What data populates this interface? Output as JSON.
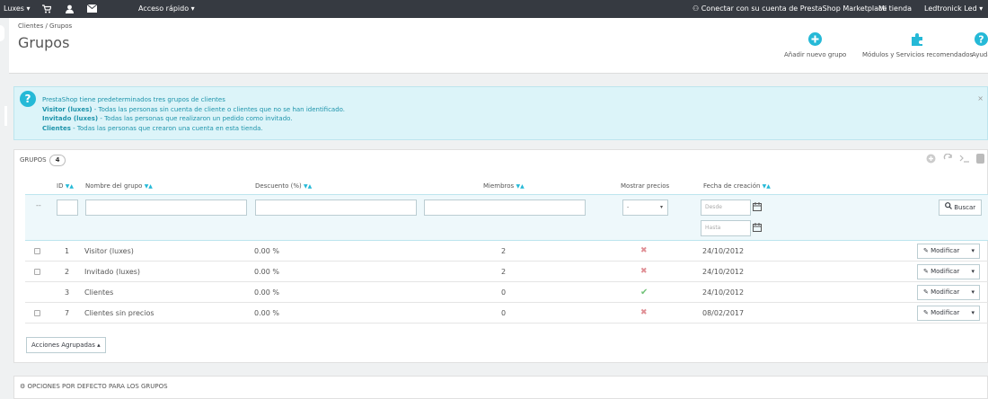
{
  "topbar": {
    "shop": "Luxes",
    "quick_access": "Acceso rápido",
    "marketplace": "Conectar con su cuenta de PrestaShop Marketplace",
    "my_shop": "Mi tienda",
    "user": "Ledtronick Led"
  },
  "header": {
    "breadcrumb": "Clientes  /  Grupos",
    "title": "Grupos",
    "buttons": {
      "add": "Añadir nuevo grupo",
      "modules": "Módulos y Servicios recomendados",
      "help": "Ayuda"
    }
  },
  "alert": {
    "intro": "PrestaShop tiene predeterminados tres grupos de clientes",
    "lines": [
      {
        "bold": "Visitor (luxes)",
        "text": " - Todas las personas sin cuenta de cliente o clientes que no se han identificado."
      },
      {
        "bold": "Invitado (luxes)",
        "text": " - Todas las personas que realizaron un pedido como invitado."
      },
      {
        "bold": "Clientes",
        "text": " - Todas las personas que crearon una cuenta en esta tienda."
      }
    ],
    "close": "×"
  },
  "panel": {
    "title": "GRUPOS",
    "count": "4",
    "columns": {
      "id": "ID",
      "name": "Nombre del grupo",
      "discount": "Descuento (%)",
      "members": "Miembros",
      "show_prices": "Mostrar precios",
      "created": "Fecha de creación"
    },
    "filter": {
      "select_value": "-",
      "from_placeholder": "Desde",
      "to_placeholder": "Hasta",
      "search_label": "Buscar",
      "dash": "--"
    },
    "rows": [
      {
        "checkbox": true,
        "id": "1",
        "name": "Visitor (luxes)",
        "discount": "0.00 %",
        "members": "2",
        "show_prices": false,
        "date": "24/10/2012",
        "action": "Modificar"
      },
      {
        "checkbox": true,
        "id": "2",
        "name": "Invitado (luxes)",
        "discount": "0.00 %",
        "members": "2",
        "show_prices": false,
        "date": "24/10/2012",
        "action": "Modificar"
      },
      {
        "checkbox": false,
        "id": "3",
        "name": "Clientes",
        "discount": "0.00 %",
        "members": "0",
        "show_prices": true,
        "date": "24/10/2012",
        "action": "Modificar"
      },
      {
        "checkbox": true,
        "id": "7",
        "name": "Clientes sin precios",
        "discount": "0.00 %",
        "members": "0",
        "show_prices": false,
        "date": "08/02/2017",
        "action": "Modificar"
      }
    ],
    "bulk_actions": "Acciones Agrupadas"
  },
  "options_panel": {
    "title": "OPCIONES POR DEFECTO PARA LOS GRUPOS"
  },
  "colors": {
    "topbar": "#363a41",
    "accent": "#25b9d7",
    "alert_bg": "#dcf4f9",
    "no": "#e08f95",
    "yes": "#72c279"
  },
  "icons": {
    "cart": "cart-icon",
    "user": "user-icon",
    "mail": "envelope-icon",
    "add": "plus-circle-icon",
    "modules": "puzzle-icon",
    "help": "question-circle-icon",
    "search": "search-icon",
    "calendar": "calendar-icon",
    "edit": "pencil-icon",
    "yes": "check-icon",
    "no": "cross-icon",
    "options": "gears-icon"
  }
}
